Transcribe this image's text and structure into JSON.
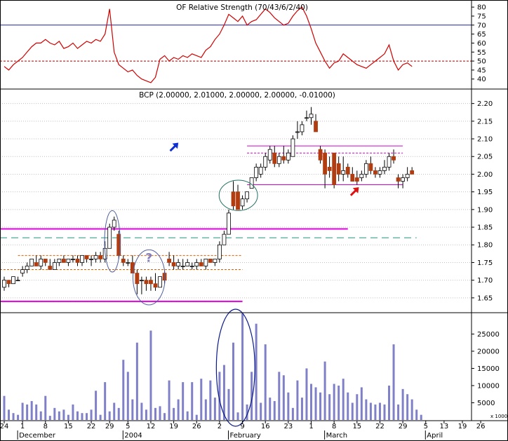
{
  "chart_data": [
    {
      "type": "line",
      "title": "OF Relative Strength (70/43/6/2/40)",
      "ylim": [
        36,
        82
      ],
      "yticks": [
        40,
        45,
        50,
        55,
        60,
        65,
        70,
        75,
        80
      ],
      "ytick_labels": [
        "40",
        "45",
        "50",
        "55",
        "60",
        "65",
        "70",
        "75",
        "80"
      ],
      "color": "#d00000",
      "reference_lines": [
        {
          "y": 70,
          "style": "solid",
          "color": "#2020a0"
        },
        {
          "y": 50,
          "style": "dashed",
          "color": "#a00000"
        }
      ],
      "series": [
        {
          "x": [
            0,
            1,
            2,
            3,
            4,
            5,
            6,
            7,
            8,
            9,
            10,
            11,
            12,
            13,
            14,
            15,
            16,
            17,
            18,
            19,
            20,
            21,
            22,
            23,
            24,
            25,
            26,
            27,
            28,
            29,
            30,
            31,
            32,
            33,
            34,
            35,
            36,
            37,
            38,
            39,
            40,
            41,
            42,
            43,
            44,
            45,
            46,
            47,
            48,
            49,
            50,
            51,
            52,
            53,
            54,
            55,
            56,
            57,
            58,
            59,
            60,
            61,
            62,
            63,
            64,
            65,
            66,
            67,
            68,
            69,
            70,
            71,
            72,
            73,
            74,
            75,
            76,
            77,
            78,
            79,
            80,
            81,
            82,
            83,
            84,
            85,
            86,
            87,
            88,
            89
          ],
          "values": [
            47,
            45,
            48,
            50,
            52,
            55,
            58,
            60,
            60,
            62,
            60,
            59,
            61,
            57,
            58,
            60,
            57,
            59,
            61,
            60,
            62,
            61,
            65,
            79,
            55,
            48,
            46,
            44,
            45,
            42,
            40,
            39,
            38,
            41,
            51,
            53,
            50,
            52,
            51,
            53,
            52,
            54,
            53,
            52,
            56,
            58,
            62,
            65,
            70,
            76,
            74,
            72,
            75,
            70,
            72,
            73,
            76,
            79,
            77,
            74,
            72,
            70,
            71,
            75,
            78,
            80,
            75,
            68,
            60,
            55,
            50,
            46,
            49,
            50,
            54,
            52,
            50,
            48,
            47,
            46,
            48,
            50,
            52,
            54,
            59,
            50,
            45,
            48,
            49,
            47
          ]
        }
      ]
    },
    {
      "type": "candlestick",
      "title": "BCP (2.00000, 2.01000, 2.00000, 2.00000, -0.01000)",
      "ylim": [
        1.61,
        2.235
      ],
      "yticks": [
        1.65,
        1.7,
        1.75,
        1.8,
        1.85,
        1.9,
        1.95,
        2.0,
        2.05,
        2.1,
        2.15,
        2.2
      ],
      "ytick_labels": [
        "1.65",
        "1.70",
        "1.75",
        "1.80",
        "1.85",
        "1.90",
        "1.95",
        "2.00",
        "2.05",
        "2.10",
        "2.15",
        "2.20"
      ],
      "up_color": "#ffffff",
      "down_color": "#b03c10",
      "candles": [
        [
          1.68,
          1.71,
          1.67,
          1.7
        ],
        [
          1.7,
          1.7,
          1.68,
          1.69
        ],
        [
          1.69,
          1.71,
          1.69,
          1.71
        ],
        [
          1.7,
          1.71,
          1.7,
          1.7
        ],
        [
          1.72,
          1.74,
          1.71,
          1.73
        ],
        [
          1.73,
          1.75,
          1.72,
          1.74
        ],
        [
          1.74,
          1.76,
          1.74,
          1.76
        ],
        [
          1.75,
          1.77,
          1.74,
          1.74
        ],
        [
          1.74,
          1.77,
          1.73,
          1.76
        ],
        [
          1.76,
          1.76,
          1.74,
          1.75
        ],
        [
          1.74,
          1.76,
          1.73,
          1.73
        ],
        [
          1.73,
          1.76,
          1.73,
          1.75
        ],
        [
          1.75,
          1.76,
          1.74,
          1.76
        ],
        [
          1.76,
          1.77,
          1.75,
          1.75
        ],
        [
          1.75,
          1.76,
          1.74,
          1.76
        ],
        [
          1.76,
          1.77,
          1.75,
          1.76
        ],
        [
          1.76,
          1.77,
          1.74,
          1.75
        ],
        [
          1.75,
          1.77,
          1.74,
          1.77
        ],
        [
          1.77,
          1.77,
          1.75,
          1.76
        ],
        [
          1.76,
          1.77,
          1.74,
          1.76
        ],
        [
          1.76,
          1.78,
          1.75,
          1.77
        ],
        [
          1.77,
          1.78,
          1.75,
          1.76
        ],
        [
          1.76,
          1.81,
          1.75,
          1.79
        ],
        [
          1.79,
          1.86,
          1.79,
          1.85
        ],
        [
          1.85,
          1.88,
          1.84,
          1.87
        ],
        [
          1.83,
          1.84,
          1.76,
          1.77
        ],
        [
          1.76,
          1.77,
          1.74,
          1.75
        ],
        [
          1.75,
          1.76,
          1.74,
          1.75
        ],
        [
          1.75,
          1.77,
          1.72,
          1.72
        ],
        [
          1.72,
          1.73,
          1.66,
          1.69
        ],
        [
          1.7,
          1.71,
          1.66,
          1.7
        ],
        [
          1.7,
          1.71,
          1.67,
          1.69
        ],
        [
          1.7,
          1.71,
          1.67,
          1.69
        ],
        [
          1.69,
          1.72,
          1.67,
          1.68
        ],
        [
          1.68,
          1.71,
          1.68,
          1.71
        ],
        [
          1.72,
          1.73,
          1.69,
          1.7
        ],
        [
          1.76,
          1.78,
          1.74,
          1.75
        ],
        [
          1.75,
          1.77,
          1.73,
          1.74
        ],
        [
          1.74,
          1.76,
          1.73,
          1.75
        ],
        [
          1.74,
          1.76,
          1.73,
          1.74
        ],
        [
          1.74,
          1.76,
          1.74,
          1.75
        ],
        [
          1.74,
          1.75,
          1.73,
          1.74
        ],
        [
          1.74,
          1.76,
          1.73,
          1.75
        ],
        [
          1.75,
          1.76,
          1.74,
          1.74
        ],
        [
          1.74,
          1.76,
          1.73,
          1.76
        ],
        [
          1.76,
          1.76,
          1.75,
          1.75
        ],
        [
          1.75,
          1.76,
          1.74,
          1.76
        ],
        [
          1.76,
          1.81,
          1.75,
          1.8
        ],
        [
          1.8,
          1.84,
          1.8,
          1.83
        ],
        [
          1.83,
          1.9,
          1.83,
          1.89
        ],
        [
          1.95,
          1.98,
          1.9,
          1.91
        ],
        [
          1.95,
          1.97,
          1.9,
          1.9
        ],
        [
          1.91,
          1.94,
          1.9,
          1.93
        ],
        [
          1.93,
          1.95,
          1.92,
          1.95
        ],
        [
          1.96,
          1.99,
          1.96,
          1.99
        ],
        [
          1.99,
          2.03,
          1.98,
          2.02
        ],
        [
          2.0,
          2.03,
          1.99,
          2.02
        ],
        [
          2.02,
          2.06,
          2.01,
          2.05
        ],
        [
          2.04,
          2.08,
          2.03,
          2.07
        ],
        [
          2.06,
          2.08,
          2.02,
          2.03
        ],
        [
          2.03,
          2.06,
          2.02,
          2.05
        ],
        [
          2.05,
          2.08,
          2.03,
          2.04
        ],
        [
          2.04,
          2.07,
          2.03,
          2.06
        ],
        [
          2.05,
          2.11,
          2.05,
          2.1
        ],
        [
          2.12,
          2.15,
          2.1,
          2.12
        ],
        [
          2.12,
          2.15,
          2.11,
          2.14
        ],
        [
          2.16,
          2.18,
          2.15,
          2.16
        ],
        [
          2.16,
          2.19,
          2.14,
          2.17
        ],
        [
          2.15,
          2.17,
          2.12,
          2.12
        ],
        [
          2.07,
          2.08,
          2.03,
          2.04
        ],
        [
          2.06,
          2.07,
          1.96,
          2.0
        ],
        [
          2.02,
          2.05,
          1.99,
          2.01
        ],
        [
          2.06,
          2.06,
          1.96,
          1.97
        ],
        [
          2.03,
          2.05,
          1.98,
          2.0
        ],
        [
          2.0,
          2.05,
          1.98,
          2.01
        ],
        [
          2.02,
          2.03,
          1.99,
          2.0
        ],
        [
          2.0,
          2.02,
          1.98,
          1.98
        ],
        [
          1.99,
          2.01,
          1.97,
          1.98
        ],
        [
          1.99,
          2.01,
          1.98,
          2.0
        ],
        [
          2.0,
          2.04,
          1.99,
          2.03
        ],
        [
          2.03,
          2.05,
          2.0,
          2.01
        ],
        [
          2.01,
          2.02,
          1.99,
          2.0
        ],
        [
          2.0,
          2.02,
          1.99,
          2.01
        ],
        [
          2.01,
          2.04,
          2.0,
          2.02
        ],
        [
          2.02,
          2.06,
          2.01,
          2.05
        ],
        [
          2.05,
          2.07,
          2.03,
          2.04
        ],
        [
          1.99,
          2.0,
          1.96,
          1.98
        ],
        [
          1.98,
          2.0,
          1.96,
          1.99
        ],
        [
          1.99,
          2.02,
          1.98,
          2.0
        ],
        [
          2.01,
          2.02,
          2.0,
          2.0
        ]
      ],
      "lines": [
        {
          "x1": -1,
          "x2": 52,
          "y": 1.64,
          "color": "#e000e0",
          "width": 2
        },
        {
          "x1": -1,
          "x2": 75,
          "y": 1.845,
          "color": "#e000e0",
          "width": 2
        },
        {
          "x1": -1,
          "x2": 90,
          "y": 1.82,
          "color": "#209080",
          "width": 1,
          "dash": "10,6"
        },
        {
          "x1": 3,
          "x2": 52,
          "y": 1.77,
          "color": "#e06000",
          "width": 1,
          "dash": "3,2"
        },
        {
          "x1": -1,
          "x2": 52,
          "y": 1.73,
          "color": "#e06000",
          "width": 1,
          "dash": "3,2"
        },
        {
          "x1": 53,
          "x2": 87,
          "y": 2.08,
          "color": "#d000d0",
          "width": 1
        },
        {
          "x1": 53,
          "x2": 87,
          "y": 2.06,
          "color": "#d000d0",
          "width": 1,
          "dash": "3,2"
        },
        {
          "x1": 53,
          "x2": 87,
          "y": 1.97,
          "color": "#d000d0",
          "width": 1
        }
      ],
      "ellipses": [
        {
          "cx": 23.6,
          "cy": 1.81,
          "rx": 1.7,
          "ry": 0.087
        },
        {
          "cx": 31.6,
          "cy": 1.708,
          "rx": 3.5,
          "ry": 0.078
        },
        {
          "cx": 51.1,
          "cy": 1.94,
          "rx": 4.2,
          "ry": 0.043
        }
      ],
      "annotations": [
        {
          "text": "?",
          "x": 31.6,
          "y": 1.752,
          "color": "#8080c0"
        }
      ],
      "arrows": [
        {
          "x": 37,
          "y": 2.076,
          "color": "#1030d0",
          "direction": "up-right"
        },
        {
          "x": 76.4,
          "y": 1.95,
          "color": "#e01010",
          "direction": "up-right"
        }
      ]
    },
    {
      "type": "bar",
      "ylim": [
        0,
        31000
      ],
      "yticks": [
        5000,
        10000,
        15000,
        20000,
        25000
      ],
      "ytick_labels": [
        "5000",
        "10000",
        "15000",
        "20000",
        "25000"
      ],
      "unit_label": "x 1000",
      "color": "#8080c8",
      "values": [
        7000,
        3000,
        2000,
        1500,
        5000,
        4500,
        5500,
        4500,
        2500,
        7000,
        1200,
        3500,
        2500,
        3000,
        1500,
        4500,
        2500,
        2000,
        2000,
        3000,
        8500,
        1500,
        11000,
        2500,
        5000,
        3500,
        17500,
        14000,
        6000,
        22500,
        5000,
        3000,
        26000,
        3500,
        4000,
        2000,
        11500,
        3500,
        6000,
        11000,
        2500,
        11000,
        1500,
        12000,
        6000,
        11500,
        6500,
        14000,
        16000,
        9000,
        22500,
        2200,
        31000,
        4500,
        14000,
        28000,
        5000,
        22000,
        6500,
        5500,
        14000,
        13000,
        8000,
        3500,
        11500,
        6500,
        15000,
        10500,
        9500,
        8000,
        17000,
        7500,
        10500,
        10000,
        12000,
        8000,
        5000,
        7500,
        9500,
        6000,
        5000,
        4500,
        5000,
        4500,
        10000,
        22000,
        4500,
        9000,
        7500,
        6000,
        3000,
        1500
      ],
      "ellipses": [
        {
          "cx": 50.5,
          "rx": 4.2,
          "y_top": 31000
        }
      ]
    }
  ],
  "x_axis": {
    "day_labels": [
      {
        "i": 0,
        "text": "24"
      },
      {
        "i": 4,
        "text": "1"
      },
      {
        "i": 9,
        "text": "8"
      },
      {
        "i": 14,
        "text": "15"
      },
      {
        "i": 19,
        "text": "22"
      },
      {
        "i": 23,
        "text": "29"
      },
      {
        "i": 27,
        "text": "5"
      },
      {
        "i": 32,
        "text": "12"
      },
      {
        "i": 37,
        "text": "19"
      },
      {
        "i": 42,
        "text": "26"
      },
      {
        "i": 47,
        "text": "2"
      },
      {
        "i": 52,
        "text": "9"
      },
      {
        "i": 57,
        "text": "16"
      },
      {
        "i": 62,
        "text": "23"
      },
      {
        "i": 67,
        "text": "1"
      },
      {
        "i": 72,
        "text": "8"
      },
      {
        "i": 77,
        "text": "15"
      },
      {
        "i": 82,
        "text": "22"
      },
      {
        "i": 87,
        "text": "29"
      },
      {
        "i": 92,
        "text": "5"
      },
      {
        "i": 96,
        "text": "13"
      },
      {
        "i": 100,
        "text": "19"
      },
      {
        "i": 104,
        "text": "26"
      }
    ],
    "month_labels": [
      {
        "i": 4,
        "text": "December"
      },
      {
        "i": 27,
        "text": "2004"
      },
      {
        "i": 50,
        "text": "February"
      },
      {
        "i": 71,
        "text": "March"
      },
      {
        "i": 93,
        "text": "April"
      }
    ]
  },
  "colors": {
    "axis": "#000000",
    "grid": "#c0c0c0",
    "volume": "#8080c8"
  }
}
